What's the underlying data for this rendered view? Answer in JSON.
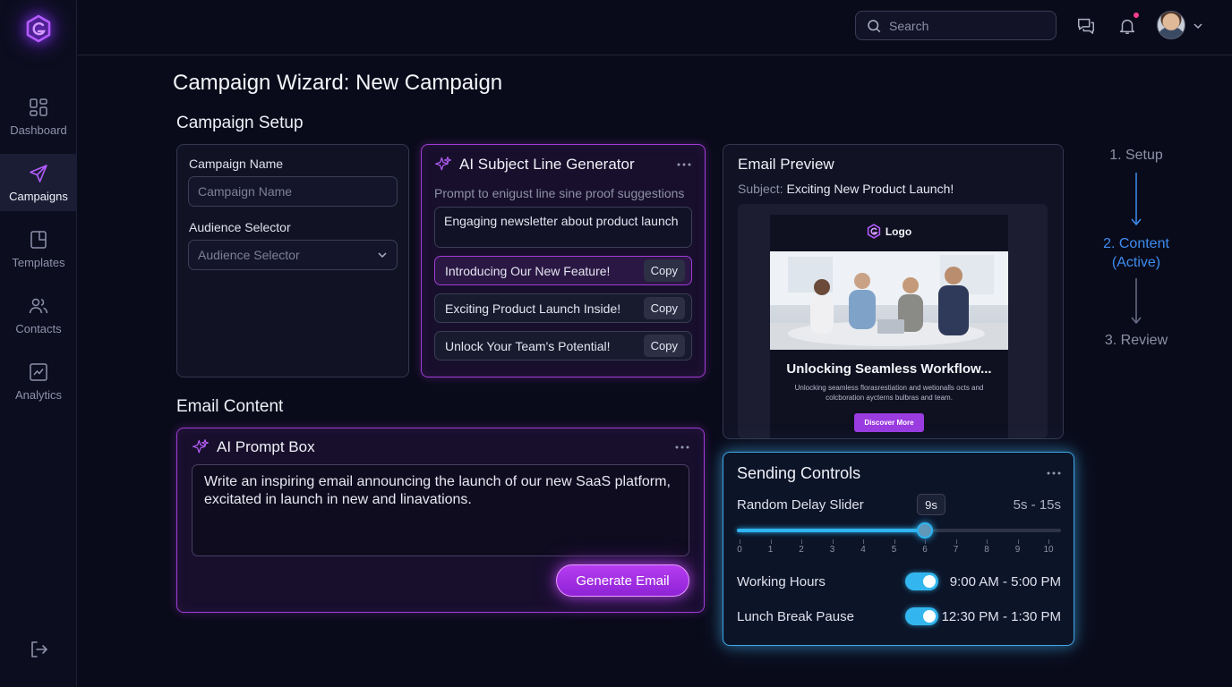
{
  "sidebar": {
    "items": [
      {
        "label": "Dashboard",
        "icon": "dashboard-icon"
      },
      {
        "label": "Campaigns",
        "icon": "paper-plane-icon",
        "active": true
      },
      {
        "label": "Templates",
        "icon": "templates-icon"
      },
      {
        "label": "Contacts",
        "icon": "contacts-icon"
      },
      {
        "label": "Analytics",
        "icon": "analytics-icon"
      }
    ]
  },
  "topbar": {
    "search_placeholder": "Search",
    "has_notification": true
  },
  "page": {
    "title": "Campaign Wizard: New Campaign"
  },
  "setup": {
    "section_title": "Campaign Setup",
    "campaign_name_label": "Campaign Name",
    "campaign_name_placeholder": "Campaign Name",
    "audience_label": "Audience Selector",
    "audience_value": "Audience Selector"
  },
  "subject_gen": {
    "title": "AI Subject Line Generator",
    "hint": "Prompt to enigust line sine proof suggestions",
    "prompt": "Engaging newsletter about product launch",
    "copy_label": "Copy",
    "suggestions": [
      "Introducing Our New Feature!",
      "Exciting Product Launch Inside!",
      "Unlock Your Team's Potential!"
    ]
  },
  "preview": {
    "title": "Email Preview",
    "subject_label": "Subject:",
    "subject": "Exciting New Product Launch!",
    "mock_logo": "Logo",
    "mock_heading": "Unlocking Seamless Workflow...",
    "mock_body": "Unlocking seamless florasrestiation and wetionalls octs and colcboration aycterns bulbras and team.",
    "mock_button": "Discover More"
  },
  "stepper": {
    "steps": [
      "1. Setup",
      "2. Content\n(Active)",
      "3. Review"
    ]
  },
  "content": {
    "section_title": "Email Content",
    "prompt_title": "AI Prompt Box",
    "prompt_text": "Write an inspiring email announcing the launch of our new SaaS platform, excitated in launch in new and linavations.",
    "generate_label": "Generate Email"
  },
  "sending": {
    "title": "Sending Controls",
    "delay_label": "Random Delay Slider",
    "delay_value": 6,
    "delay_value_text": "9s",
    "delay_range": "5s - 15s",
    "ticks": [
      "0",
      "1",
      "2",
      "3",
      "4",
      "5",
      "6",
      "7",
      "8",
      "9",
      "10"
    ],
    "working_hours_label": "Working Hours",
    "working_hours": "9:00 AM - 5:00 PM",
    "working_hours_on": true,
    "lunch_label": "Lunch Break Pause",
    "lunch_hours": "12:30 PM - 1:30 PM",
    "lunch_on": true
  },
  "colors": {
    "accent_purple": "#a23bd6",
    "accent_blue": "#3fa9e8",
    "active_step": "#3d8cf0"
  }
}
